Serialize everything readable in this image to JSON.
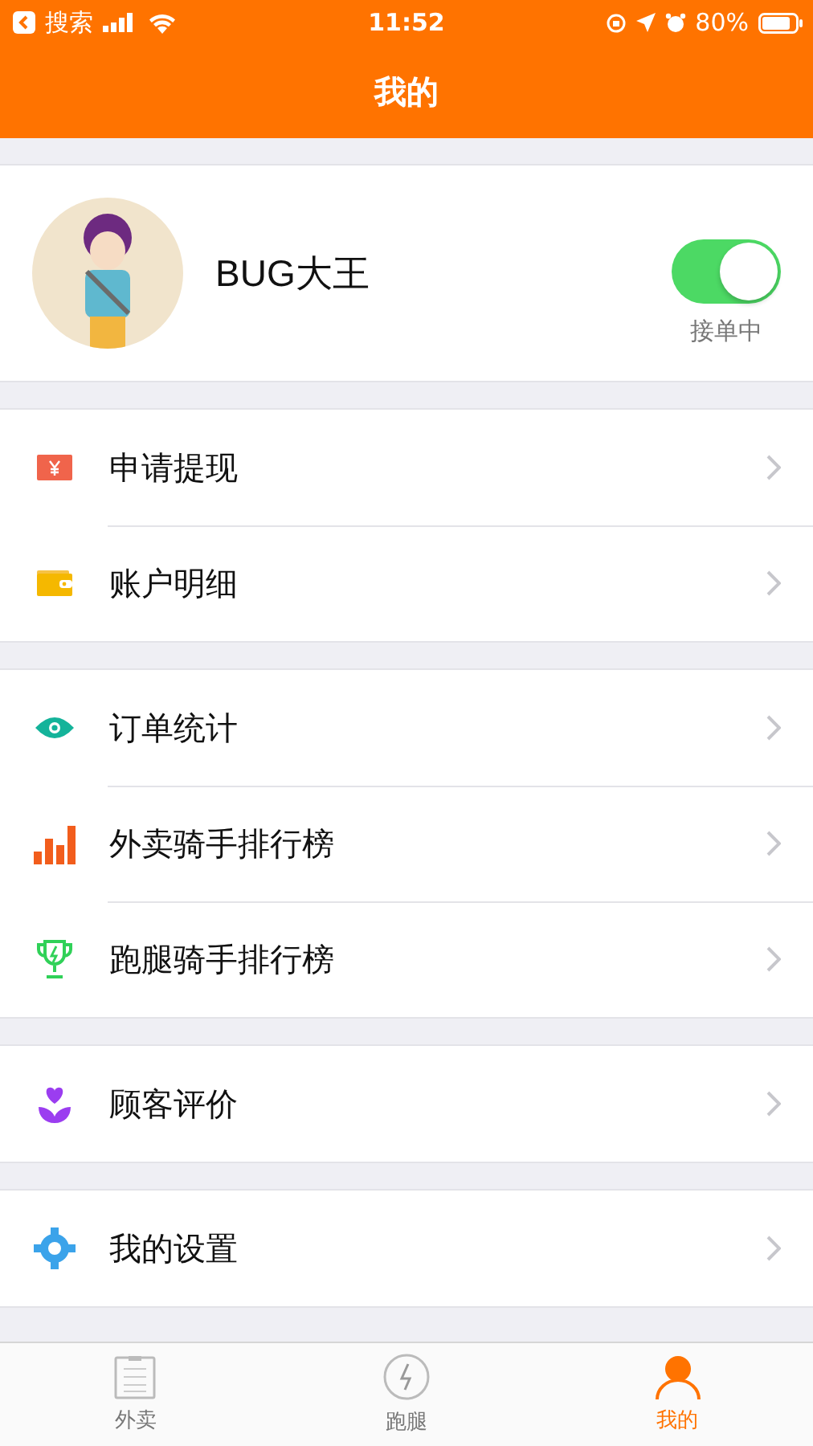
{
  "status_bar": {
    "back_app": "搜索",
    "time": "11:52",
    "battery": "80%"
  },
  "nav": {
    "title": "我的"
  },
  "profile": {
    "name": "BUG大王",
    "toggle": {
      "on": true,
      "label": "接单中"
    }
  },
  "groups": [
    {
      "items": [
        {
          "kind": "money",
          "label": "申请提现"
        },
        {
          "kind": "wallet",
          "label": "账户明细"
        }
      ]
    },
    {
      "items": [
        {
          "kind": "eye",
          "label": "订单统计"
        },
        {
          "kind": "bars",
          "label": "外卖骑手排行榜"
        },
        {
          "kind": "trophy",
          "label": "跑腿骑手排行榜"
        }
      ]
    },
    {
      "items": [
        {
          "kind": "flower",
          "label": "顾客评价"
        }
      ]
    },
    {
      "items": [
        {
          "kind": "gear",
          "label": "我的设置"
        }
      ]
    }
  ],
  "tabs": [
    {
      "kind": "list",
      "label": "外卖",
      "selected": false
    },
    {
      "kind": "bolt",
      "label": "跑腿",
      "selected": false
    },
    {
      "kind": "person",
      "label": "我的",
      "selected": true
    }
  ]
}
